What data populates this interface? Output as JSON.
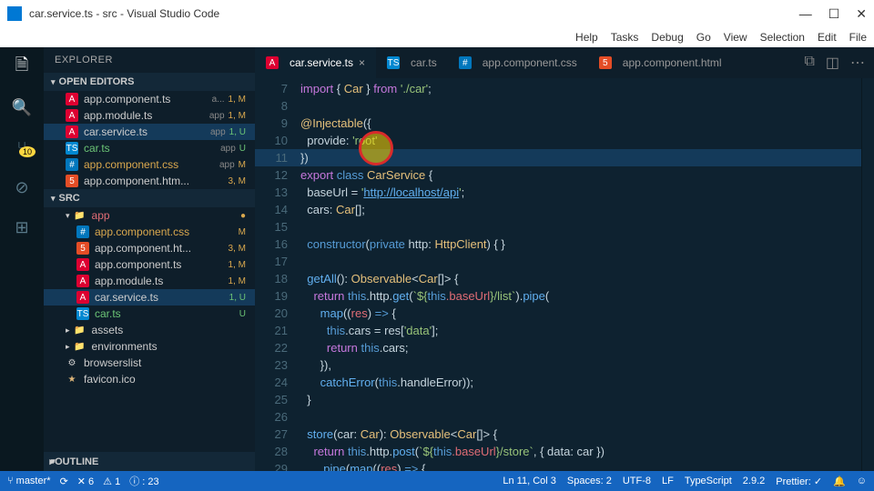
{
  "window": {
    "title": "car.service.ts - src - Visual Studio Code"
  },
  "menu": {
    "items": [
      "Help",
      "Tasks",
      "Debug",
      "Go",
      "View",
      "Selection",
      "Edit",
      "File"
    ]
  },
  "activity": {
    "badge": "10"
  },
  "explorer": {
    "title": "EXPLORER"
  },
  "openEditors": {
    "title": "OPEN EDITORS",
    "items": [
      {
        "icon": "ng",
        "name": "app.component.ts",
        "tag": "a...",
        "status": "1, M"
      },
      {
        "icon": "ng",
        "name": "app.module.ts",
        "tag": "app",
        "status": "1, M"
      },
      {
        "icon": "ng",
        "name": "car.service.ts",
        "tag": "app",
        "status": "1, U",
        "selected": true
      },
      {
        "icon": "ts",
        "name": "car.ts",
        "tag": "app",
        "status": "U"
      },
      {
        "icon": "css",
        "name": "app.component.css",
        "tag": "app",
        "status": "M",
        "yellow": true
      },
      {
        "icon": "html",
        "name": "app.component.htm...",
        "tag": "",
        "status": "3, M"
      }
    ]
  },
  "src": {
    "title": "SRC",
    "app": "app",
    "items": [
      {
        "icon": "css",
        "name": "app.component.css",
        "status": "M",
        "yellow": true
      },
      {
        "icon": "html",
        "name": "app.component.ht...",
        "status": "3, M"
      },
      {
        "icon": "ng",
        "name": "app.component.ts",
        "status": "1, M"
      },
      {
        "icon": "ng",
        "name": "app.module.ts",
        "status": "1, M"
      },
      {
        "icon": "ng",
        "name": "car.service.ts",
        "status": "1, U",
        "selected": true
      },
      {
        "icon": "ts",
        "name": "car.ts",
        "status": "U"
      }
    ],
    "folders": [
      {
        "name": "assets"
      },
      {
        "name": "environments"
      }
    ],
    "files": [
      {
        "name": "browserslist"
      },
      {
        "name": "favicon.ico"
      }
    ]
  },
  "outline": {
    "title": "OUTLINE"
  },
  "tabs": [
    {
      "icon": "ng",
      "name": "car.service.ts",
      "active": true,
      "close": true
    },
    {
      "icon": "ts",
      "name": "car.ts"
    },
    {
      "icon": "css",
      "name": "app.component.css"
    },
    {
      "icon": "html",
      "name": "app.component.html"
    }
  ],
  "code": {
    "l7a": "import",
    "l7b": " { ",
    "l7c": "Car",
    "l7d": " } ",
    "l7e": "from ",
    "l7f": "'./car'",
    "l7g": ";",
    "l9a": "@Injectable",
    "l9b": "({",
    "l10a": "  provide",
    "l10c": ": ",
    "l10d": "'root'",
    "l11a": "})",
    "l12a": "export ",
    "l12b": "class ",
    "l12c": "CarService",
    "l12d": " {",
    "l13a": "  baseUrl = ",
    "l13b": "'",
    "l13c": "http://localhost/api",
    "l13d": "'",
    "l13e": ";",
    "l14a": "  cars: ",
    "l14b": "Car",
    "l14c": "[];",
    "l16a": "  ",
    "l16b": "constructor",
    "l16c": "(",
    "l16d": "private",
    "l16e": " http: ",
    "l16f": "HttpClient",
    "l16g": ") { }",
    "l18a": "  ",
    "l18b": "getAll",
    "l18c": "(): ",
    "l18d": "Observable",
    "l18e": "<",
    "l18f": "Car",
    "l18g": "[]> {",
    "l19a": "    ",
    "l19b": "return ",
    "l19c": "this",
    "l19d": ".http.",
    "l19e": "get",
    "l19f": "(",
    "l19g": "`${",
    "l19h": "this",
    "l19i": ".baseUrl",
    "l19j": "}",
    "l19k": "/list`",
    "l19l": ").",
    "l19m": "pipe",
    "l19n": "(",
    "l20a": "      ",
    "l20b": "map",
    "l20c": "((",
    "l20d": "res",
    "l20e": ") ",
    "l20f": "=>",
    "l20g": " {",
    "l21a": "        ",
    "l21b": "this",
    "l21c": ".cars = res[",
    "l21d": "'data'",
    "l21e": "];",
    "l22a": "        ",
    "l22b": "return ",
    "l22c": "this",
    "l22d": ".cars;",
    "l23a": "      }),",
    "l24a": "      ",
    "l24b": "catchError",
    "l24c": "(",
    "l24d": "this",
    "l24e": ".handleError));",
    "l25a": "  }",
    "l27a": "  ",
    "l27b": "store",
    "l27c": "(car: ",
    "l27d": "Car",
    "l27e": "): ",
    "l27f": "Observable",
    "l27g": "<",
    "l27h": "Car",
    "l27i": "[]> {",
    "l28a": "    ",
    "l28b": "return ",
    "l28c": "this",
    "l28d": ".http.",
    "l28e": "post",
    "l28f": "(",
    "l28g": "`${",
    "l28h": "this",
    "l28i": ".baseUrl",
    "l28j": "}",
    "l28k": "/store`",
    "l28l": ", { data: car })",
    "l29a": "      .",
    "l29b": "pipe",
    "l29c": "(",
    "l29d": "map",
    "l29e": "((",
    "l29f": "res",
    "l29g": ") ",
    "l29h": "=>",
    "l29i": " {"
  },
  "status": {
    "branch": "master*",
    "sync": "",
    "errors": "✕ 6",
    "warnings": "⚠ 1",
    "info": "ⓘ : 23",
    "pos": "Ln 11, Col 3",
    "spaces": "Spaces: 2",
    "enc": "UTF-8",
    "eol": "LF",
    "lang": "TypeScript",
    "ver": "2.9.2",
    "prettier": "Prettier: ✓",
    "bell": "🔔",
    "smile": "☺"
  }
}
